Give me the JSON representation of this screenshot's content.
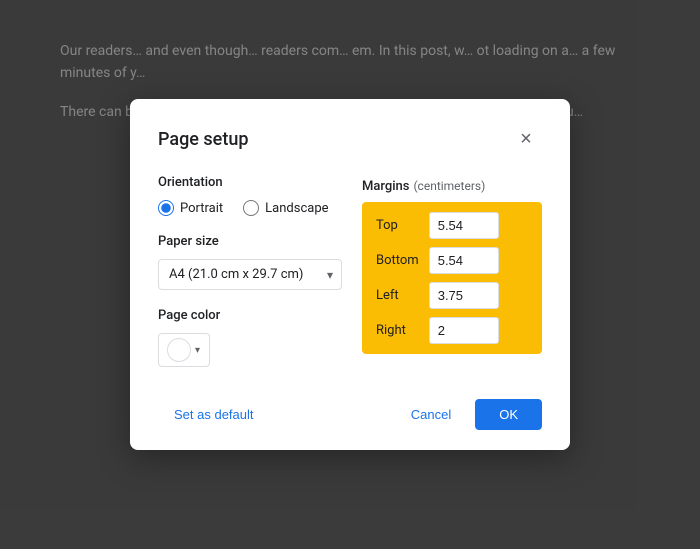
{
  "background": {
    "paragraph1": "Our readers... and even though... readers com... em. In this post, w... ot loading on a... a few minutes of y...",
    "paragraph2": "There can b... comments r... ox on the mobile, ... ly see the default '... ent here, it wou..."
  },
  "dialog": {
    "title": "Page setup",
    "close_label": "×",
    "orientation": {
      "label": "Orientation",
      "options": [
        {
          "value": "portrait",
          "label": "Portrait",
          "checked": true
        },
        {
          "value": "landscape",
          "label": "Landscape",
          "checked": false
        }
      ]
    },
    "paper_size": {
      "label": "Paper size",
      "value": "A4 (21.0 cm x 29.7 cm)",
      "chevron": "▾"
    },
    "page_color": {
      "label": "Page color"
    },
    "margins": {
      "label": "Margins",
      "unit": "(centimeters)",
      "fields": [
        {
          "label": "Top",
          "value": "5.54"
        },
        {
          "label": "Bottom",
          "value": "5.54"
        },
        {
          "label": "Left",
          "value": "3.75"
        },
        {
          "label": "Right",
          "value": "2"
        }
      ]
    },
    "footer": {
      "set_default_label": "Set as default",
      "cancel_label": "Cancel",
      "ok_label": "OK"
    }
  }
}
